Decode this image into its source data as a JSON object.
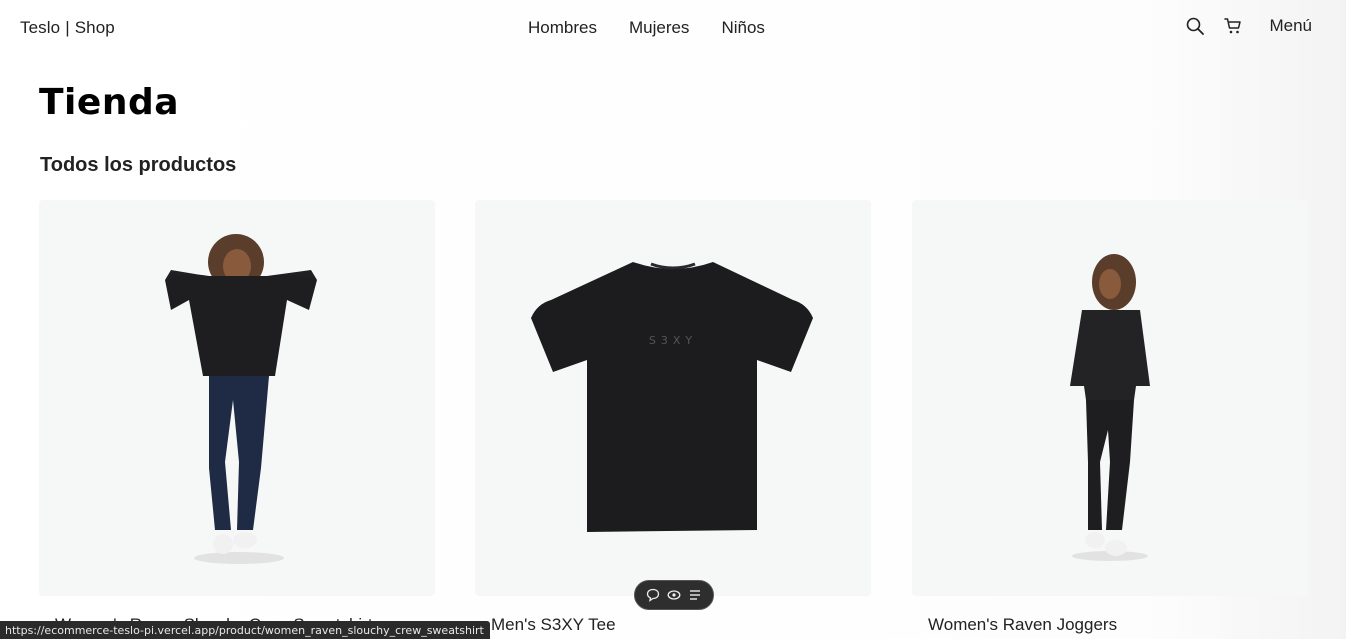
{
  "header": {
    "brand_name": "Teslo",
    "brand_sep": "|",
    "brand_suffix": "Shop",
    "nav": [
      {
        "label": "Hombres"
      },
      {
        "label": "Mujeres"
      },
      {
        "label": "Niños"
      }
    ],
    "search_icon": "search-icon",
    "cart_icon": "cart-icon",
    "menu_label": "Menú"
  },
  "main": {
    "title": "Tienda",
    "subtitle": "Todos los productos",
    "products": [
      {
        "title": "Women's Raven Slouchy Crew Sweatshirt",
        "image": "woman in black sweatshirt and jeans"
      },
      {
        "title": "Men's S3XY Tee",
        "image": "black t-shirt",
        "print": "S3XY"
      },
      {
        "title": "Women's Raven Joggers",
        "image": "woman in black sweatshirt and joggers"
      }
    ]
  },
  "floating_toolbar": {
    "icons": [
      "comment-icon",
      "eye-icon",
      "list-icon"
    ]
  },
  "status_bar": {
    "url": "https://ecommerce-teslo-pi.vercel.app/product/women_raven_slouchy_crew_sweatshirt"
  },
  "colors": {
    "card_bg": "#f6f7f7",
    "text": "#222222",
    "toolbar_bg": "#2e2e2e"
  }
}
